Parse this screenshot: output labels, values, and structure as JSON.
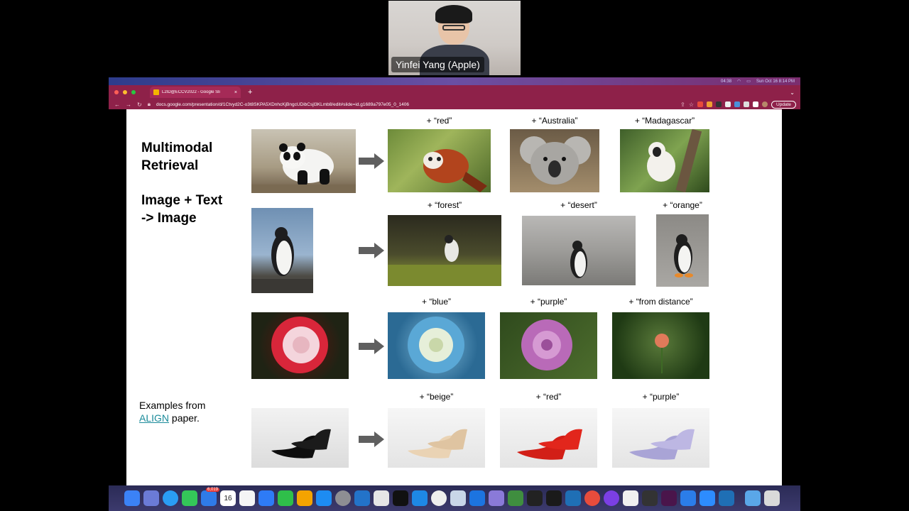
{
  "presenter": {
    "name": "Yinfei Yang (Apple)"
  },
  "browser": {
    "tab_title": "L2ID@ECCV2022 - Google Sli",
    "tab_close": "×",
    "new_tab": "+",
    "url": "docs.google.com/presentation/d/1Ctvyd2C-o3t8SKPA5XDnhcKjBngcUDibCsjl3KLmb8/edit#slide=id.g1689a797e05_0_1406",
    "update_label": "Update",
    "menubar_clock": "Sun Oct 16  8:14 PM",
    "menubar_timer": "04:38"
  },
  "slide": {
    "title_line1": "Multimodal",
    "title_line2": "Retrieval",
    "subtitle_line1": "Image + Text",
    "subtitle_line2": "-> Image",
    "examples_prefix": "Examples from",
    "examples_link": "ALIGN",
    "examples_suffix": " paper.",
    "rows": [
      {
        "query": "panda",
        "captions": [
          "+ “red”",
          "+ “Australia”",
          "+ “Madagascar”"
        ]
      },
      {
        "query": "penguin",
        "captions": [
          "+ “forest”",
          "+ “desert”",
          "+ “orange”"
        ]
      },
      {
        "query": "rose",
        "captions": [
          "+ “blue”",
          "+ “purple”",
          "+ “from distance”"
        ]
      },
      {
        "query": "heels",
        "captions": [
          "+ “beige”",
          "+ “red”",
          "+ “purple”"
        ]
      }
    ]
  },
  "dock": {
    "calendar_day": "16",
    "mail_badge": "6,019"
  },
  "colors": {
    "browser_chrome": "#8e2149",
    "link": "#1a8b9a",
    "arrow": "#5f5f5f"
  }
}
